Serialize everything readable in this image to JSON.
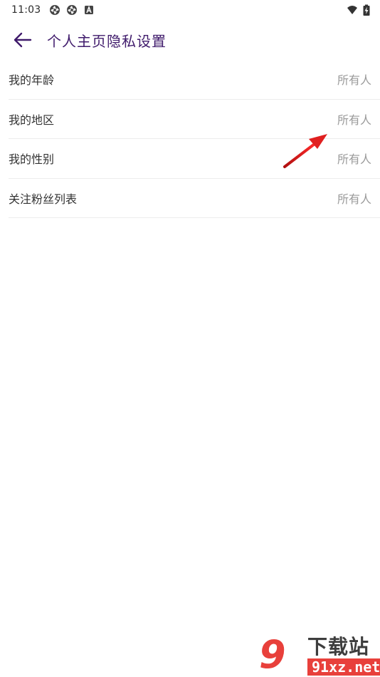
{
  "status_bar": {
    "time": "11:03",
    "left_icons": [
      "app-notification-icon",
      "app-notification-icon",
      "keyboard-a-icon"
    ],
    "right_icons": [
      "wifi-icon",
      "battery-charging-icon"
    ]
  },
  "app_bar": {
    "back_icon": "arrow-left-icon",
    "title": "个人主页隐私设置",
    "title_color": "#3f1a6b"
  },
  "settings": [
    {
      "label": "我的年龄",
      "value": "所有人"
    },
    {
      "label": "我的地区",
      "value": "所有人"
    },
    {
      "label": "我的性别",
      "value": "所有人"
    },
    {
      "label": "关注粉丝列表",
      "value": "所有人"
    }
  ],
  "annotation": {
    "icon": "red-arrow-icon",
    "color": "#e02020"
  },
  "watermark": {
    "logo_text": "9",
    "title": "下载站",
    "domain": "91xz.net",
    "accent": "#e8403b"
  }
}
